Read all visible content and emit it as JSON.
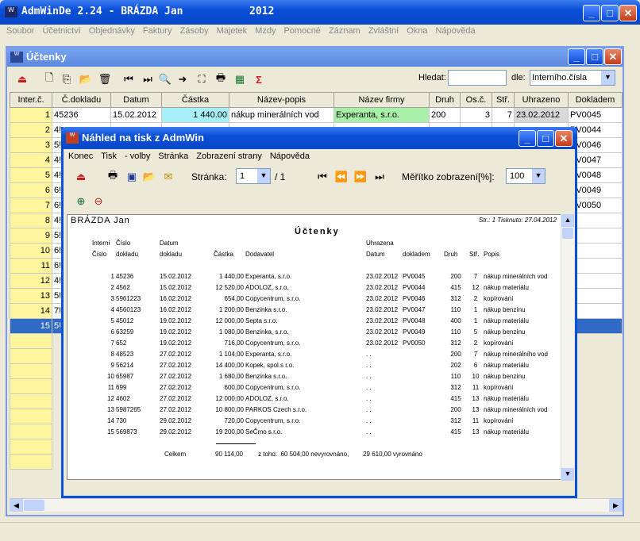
{
  "app": {
    "title": "AdmWinDe 2.24 - BRÁZDA Jan",
    "year": "2012"
  },
  "menu": [
    "Soubor",
    "Účetnictví",
    "Objednávky",
    "Faktury",
    "Zásoby",
    "Majetek",
    "Mzdy",
    "Pomocné",
    "Záznam",
    "Zvláštní",
    "Okna",
    "Nápověda"
  ],
  "child": {
    "title": "Účtenky",
    "search_label": "Hledat:",
    "by_label": "dle:",
    "by_value": "Interního.čísla"
  },
  "grid": {
    "headers": [
      "Inter.č.",
      "Č.dokladu",
      "Datum",
      "Částka",
      "Název-popis",
      "Název firmy",
      "Druh",
      "Os.č.",
      "Stř.",
      "Uhrazeno",
      "Dokladem"
    ],
    "row1": [
      "1",
      "45236",
      "15.02.2012",
      "1 440.00",
      "nákup minerálních vod",
      "Experanta, s.r.o.",
      "200",
      "3",
      "7",
      "23.02.2012",
      "PV0045"
    ],
    "left": [
      [
        "2",
        "4!"
      ],
      [
        "3",
        "5!"
      ],
      [
        "4",
        "4!"
      ],
      [
        "5",
        "4!"
      ],
      [
        "6",
        "6!"
      ],
      [
        "7",
        "6!"
      ],
      [
        "8",
        "4!"
      ],
      [
        "9",
        "5!"
      ],
      [
        "10",
        "6!"
      ],
      [
        "11",
        "6!"
      ],
      [
        "12",
        "4!"
      ],
      [
        "13",
        "5!"
      ],
      [
        "14",
        "7!"
      ],
      [
        "15",
        "5!"
      ]
    ],
    "right": [
      "PV0044",
      "PV0046",
      "PV0047",
      "PV0048",
      "PV0049",
      "PV0050"
    ]
  },
  "preview": {
    "title": "Náhled na tisk z AdmWin",
    "menu": [
      "Konec",
      "Tisk",
      "- volby",
      "Stránka",
      "Zobrazení strany",
      "Nápověda"
    ],
    "page_label": "Stránka:",
    "page_value": "1",
    "page_total": "/ 1",
    "scale_label": "Měřítko zobrazení[%]:",
    "scale_value": "100",
    "doc": {
      "owner": "BRÁZDA Jan",
      "page_info": "Str.: 1   Tisknuto: 27.04.2012",
      "heading": "Účtenky",
      "h1": [
        "Interní",
        "Číslo",
        "Datum",
        "",
        "",
        "Uhrazena",
        "",
        "",
        "",
        ""
      ],
      "h2": [
        "Číslo",
        "dokladu",
        "dokladu",
        "Částka",
        "Dodavatel",
        "Datum",
        "dokladem",
        "Druh",
        "Stř.",
        "Popis"
      ],
      "rows": [
        [
          "1",
          "45236",
          "15.02.2012",
          "1 440,00",
          "Experanta, s.r.o.",
          "23.02.2012",
          "PV0045",
          "200",
          "7",
          "nákup minerálních vod"
        ],
        [
          "2",
          "4562",
          "15.02.2012",
          "12 520,00",
          "ADOLOZ, s.r.o.",
          "23.02.2012",
          "PV0044",
          "415",
          "12",
          "nákup materiálu"
        ],
        [
          "3",
          "5961223",
          "16.02.2012",
          "654,00",
          "Copycentrum, s.r.o.",
          "23.02.2012",
          "PV0046",
          "312",
          "2",
          "kopírování"
        ],
        [
          "4",
          "4560123",
          "16.02.2012",
          "1 200,00",
          "Benzinka s.r.o.",
          "23.02.2012",
          "PV0047",
          "110",
          "1",
          "nákup benzínu"
        ],
        [
          "5",
          "45012",
          "19.02.2012",
          "12 000,00",
          "Septa s.r.o.",
          "23.02.2012",
          "PV0048",
          "400",
          "1",
          "nákup materiálu"
        ],
        [
          "6",
          "63259",
          "19.02.2012",
          "1 080,00",
          "Benzinka, s.r.o.",
          "23.02.2012",
          "PV0049",
          "110",
          "5",
          "nákup benzínu"
        ],
        [
          "7",
          "652",
          "19.02.2012",
          "716,00",
          "Copycentrum, s.r.o.",
          "23.02.2012",
          "PV0050",
          "312",
          "2",
          "kopírování"
        ],
        [
          "8",
          "48523",
          "27.02.2012",
          "1 104,00",
          "Experanta, s.r.o.",
          ". .",
          "",
          "200",
          "7",
          "nákup minerálního vod"
        ],
        [
          "9",
          "56214",
          "27.02.2012",
          "14 400,00",
          "Kopek, spol.s r.o.",
          ". .",
          "",
          "202",
          "6",
          "nákup materiálu"
        ],
        [
          "10",
          "65987",
          "27.02.2012",
          "1 680,00",
          "Benzinka s.r.o.",
          ". .",
          "",
          "110",
          "10",
          "nákup benzínu"
        ],
        [
          "11",
          "699",
          "27.02.2012",
          "600,00",
          "Copycentrum, s.r.o.",
          ". .",
          "",
          "312",
          "11",
          "kopírování"
        ],
        [
          "12",
          "4602",
          "27.02.2012",
          "12 000,00",
          "ADOLOZ, s.r.o.",
          ". .",
          "",
          "415",
          "13",
          "nákup materiálu"
        ],
        [
          "13",
          "5987265",
          "27.02.2012",
          "10 800,00",
          "PARKOS Czech s.r.o.",
          ". .",
          "",
          "200",
          "13",
          "nákup minerálních vod"
        ],
        [
          "14",
          "730",
          "29.02.2012",
          "720,00",
          "Copycentrum, s.r.o.",
          ". .",
          "",
          "312",
          "11",
          "kopírování"
        ],
        [
          "15",
          "569873",
          "29.02.2012",
          "19 200,00",
          "SeČmo s.r.o.",
          ". .",
          "",
          "415",
          "13",
          "nákup materiálu"
        ]
      ],
      "total_label": "Celkem",
      "total_value": "90 114,00",
      "total_detail": "z toho:  60 504,00 nevyrovnáno,        29 610,00 vyrovnáno"
    }
  },
  "colors": {
    "title_blue": "#0a4fd8",
    "highlight_yellow": "#fff59d",
    "amount_cyan": "#a8f0f8",
    "firm_green": "#a8f0a8",
    "selected_row": "#316ac5"
  }
}
